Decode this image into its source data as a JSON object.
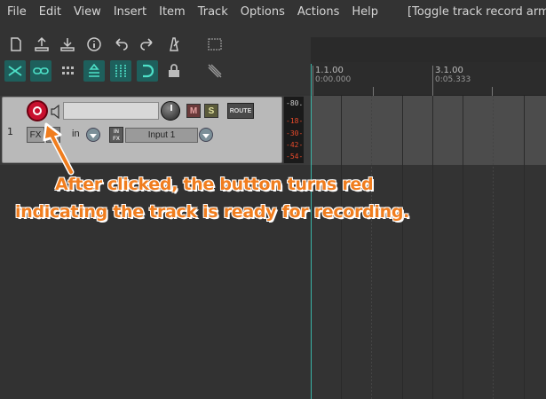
{
  "menu": {
    "items": [
      "File",
      "Edit",
      "View",
      "Insert",
      "Item",
      "Track",
      "Options",
      "Actions",
      "Help"
    ],
    "action_title": "[Toggle track record arming]"
  },
  "ruler": {
    "markers": [
      {
        "bar": "1.1.00",
        "time": "0:00.000"
      },
      {
        "bar": "3.1.00",
        "time": "0:05.333"
      }
    ]
  },
  "track": {
    "number": "1",
    "fx_label": "FX",
    "input_mode": "in",
    "infx_label": "IN\nFX",
    "input_label": "Input 1",
    "mute_label": "M",
    "solo_label": "S",
    "route_label": "ROUTE",
    "meter_labels": [
      "-80.",
      "-18-",
      "-30-",
      "-42-",
      "-54-"
    ]
  },
  "annotation": {
    "line1": "After clicked, the button turns red",
    "line2": "indicating the track is ready for recording."
  },
  "colors": {
    "record_armed": "#c8102e",
    "accent_teal": "#1e5f5c",
    "annotation": "#f07d1e"
  }
}
